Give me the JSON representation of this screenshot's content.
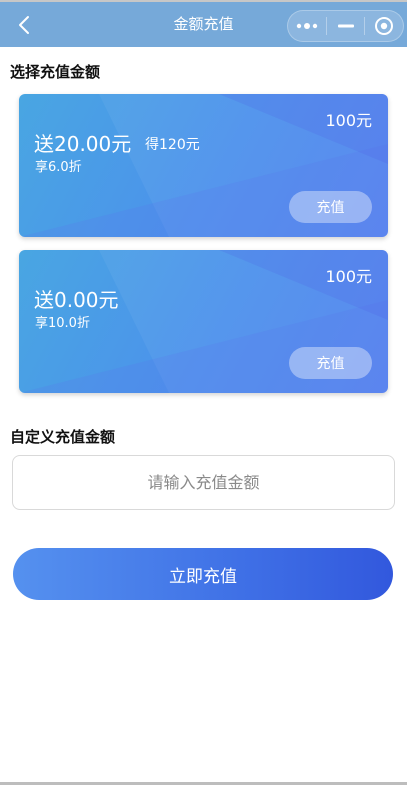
{
  "nav": {
    "title": "金额充值",
    "back_icon": "chevron-left-icon",
    "capsule": {
      "more_icon": "more-dots-icon",
      "minimize_icon": "minimize-icon",
      "close_icon": "target-circle-icon"
    },
    "bar_color": "#76a9d9"
  },
  "presets": {
    "title": "选择充值金额",
    "cards": [
      {
        "bonus": "送20.00元",
        "get": "得120元",
        "discount": "享6.0折",
        "price": "100元",
        "button": "充值"
      },
      {
        "bonus": "送0.00元",
        "get": "",
        "discount": "享10.0折",
        "price": "100元",
        "button": "充值"
      }
    ]
  },
  "custom": {
    "title": "自定义充值金额",
    "placeholder": "请输入充值金额",
    "value": ""
  },
  "submit": {
    "label": "立即充值"
  },
  "colors": {
    "card_gradient_start": "#49a6e2",
    "card_gradient_end": "#5483f0",
    "submit_gradient_start": "#5591ef",
    "submit_gradient_end": "#3258dd"
  }
}
